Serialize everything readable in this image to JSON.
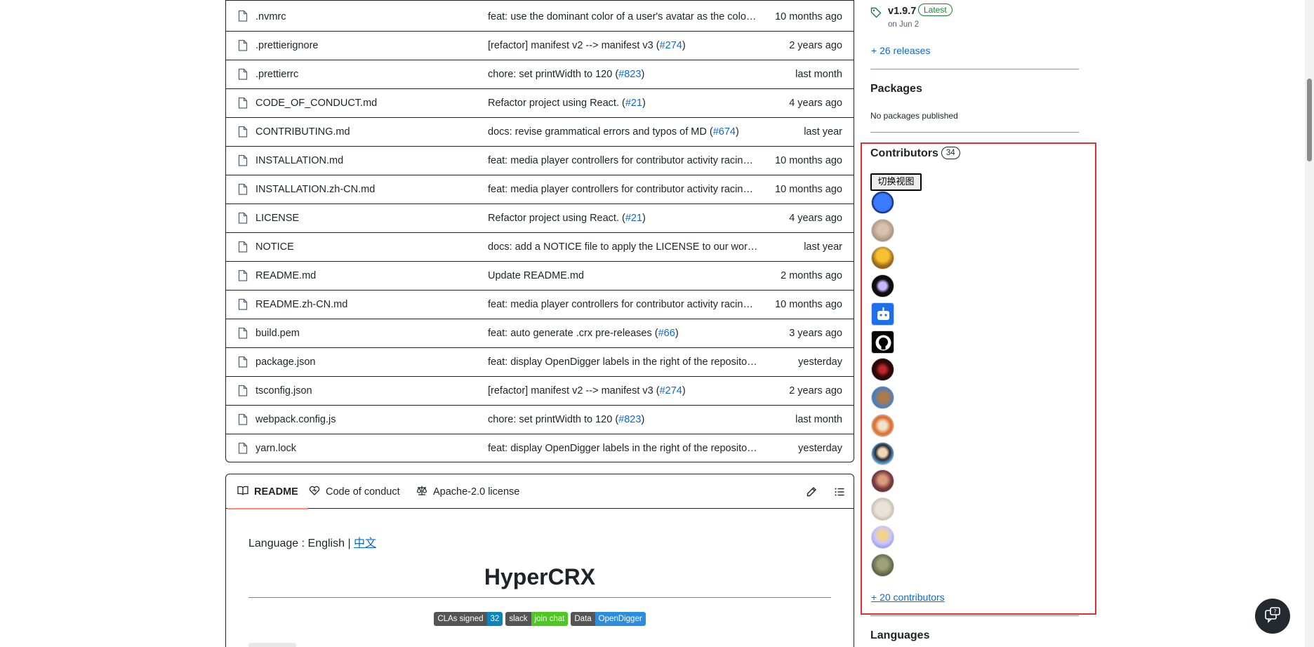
{
  "files": [
    {
      "name": ".nvmrc",
      "msg": "feat: use the dominant color of a user's avatar as the color of...",
      "pr": "",
      "msg_after": "",
      "age": "10 months ago"
    },
    {
      "name": ".prettierignore",
      "msg": "[refactor] manifest v2 --> manifest v3 (",
      "pr": "#274",
      "msg_after": ")",
      "age": "2 years ago"
    },
    {
      "name": ".prettierrc",
      "msg": "chore: set printWidth to 120 (",
      "pr": "#823",
      "msg_after": ")",
      "age": "last month"
    },
    {
      "name": "CODE_OF_CONDUCT.md",
      "msg": "Refactor project using React. (",
      "pr": "#21",
      "msg_after": ")",
      "age": "4 years ago"
    },
    {
      "name": "CONTRIBUTING.md",
      "msg": "docs: revise grammatical errors and typos of MD (",
      "pr": "#674",
      "msg_after": ")",
      "age": "last year"
    },
    {
      "name": "INSTALLATION.md",
      "msg": "feat: media player controllers for contributor activity racing ...",
      "pr": "",
      "msg_after": "",
      "age": "10 months ago"
    },
    {
      "name": "INSTALLATION.zh-CN.md",
      "msg": "feat: media player controllers for contributor activity racing ...",
      "pr": "",
      "msg_after": "",
      "age": "10 months ago"
    },
    {
      "name": "LICENSE",
      "msg": "Refactor project using React. (",
      "pr": "#21",
      "msg_after": ")",
      "age": "4 years ago"
    },
    {
      "name": "NOTICE",
      "msg": "docs: add a NOTICE file to apply the LICENSE to our work (",
      "pr": "#...",
      "msg_after": "",
      "age": "last year"
    },
    {
      "name": "README.md",
      "msg": "Update README.md",
      "pr": "",
      "msg_after": "",
      "age": "2 months ago"
    },
    {
      "name": "README.zh-CN.md",
      "msg": "feat: media player controllers for contributor activity racing ...",
      "pr": "",
      "msg_after": "",
      "age": "10 months ago"
    },
    {
      "name": "build.pem",
      "msg": "feat: auto generate .crx pre-releases (",
      "pr": "#66",
      "msg_after": ")",
      "age": "3 years ago"
    },
    {
      "name": "package.json",
      "msg": "feat: display OpenDigger labels in the right of the repository...",
      "pr": "",
      "msg_after": "",
      "age": "yesterday"
    },
    {
      "name": "tsconfig.json",
      "msg": "[refactor] manifest v2 --> manifest v3 (",
      "pr": "#274",
      "msg_after": ")",
      "age": "2 years ago"
    },
    {
      "name": "webpack.config.js",
      "msg": "chore: set printWidth to 120 (",
      "pr": "#823",
      "msg_after": ")",
      "age": "last month"
    },
    {
      "name": "yarn.lock",
      "msg": "feat: display OpenDigger labels in the right of the repository...",
      "pr": "",
      "msg_after": "",
      "age": "yesterday"
    }
  ],
  "readme": {
    "tabs": [
      "README",
      "Code of conduct",
      "Apache-2.0 license"
    ],
    "language_prefix": "Language : English | ",
    "language_link": "中文",
    "title": "HyperCRX",
    "badges": [
      {
        "left": "CLAs signed",
        "right": "32",
        "color": "#0a85bd"
      },
      {
        "left": "slack",
        "right": "join chat",
        "color": "#4dc820"
      },
      {
        "left": "Data",
        "right": "OpenDigger",
        "color": "#2b8ce0"
      }
    ]
  },
  "sidebar": {
    "release_version": "v1.9.7",
    "release_badge": "Latest",
    "release_date": "on Jun 2",
    "more_releases": "+ 26 releases",
    "packages_heading": "Packages",
    "packages_text": "No packages published",
    "contributors_heading": "Contributors",
    "contributors_count": "34",
    "switch_view_label": "切换视图",
    "more_contributors": "+ 20 contributors",
    "languages_heading": "Languages"
  },
  "colors": {
    "accent": "#0969da",
    "highlight_box": "#e03131",
    "latest_badge": "#1a7f37",
    "readme_tab_underline": "#fd8c73"
  },
  "icons": [
    "file-icon",
    "book-icon",
    "heart-icon",
    "scale-icon",
    "pencil-icon",
    "list-icon",
    "tag-icon",
    "feedback-icon"
  ]
}
